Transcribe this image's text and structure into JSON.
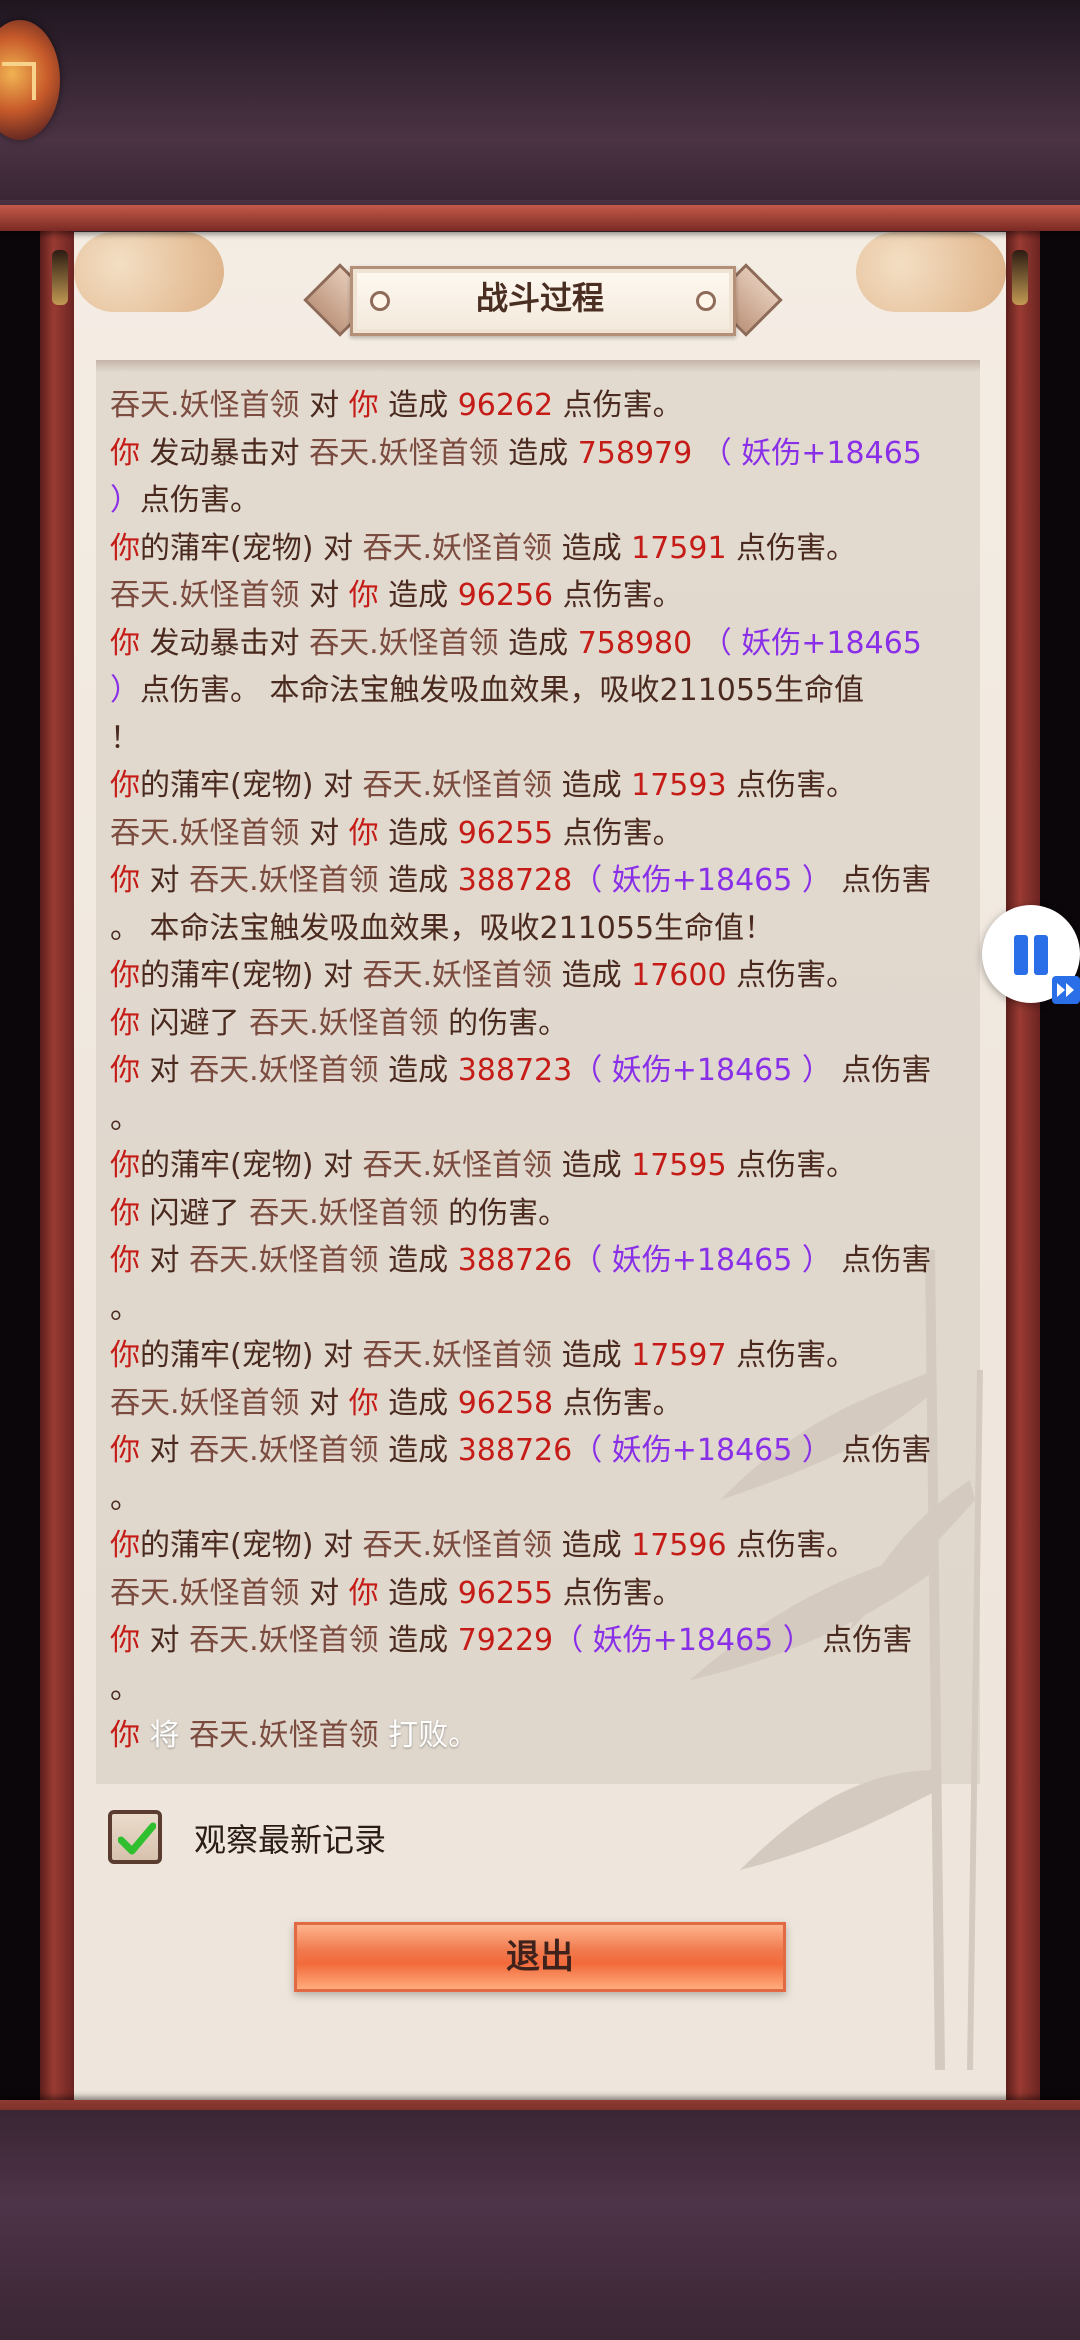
{
  "window": {
    "title": "战斗过程"
  },
  "log": {
    "lines": [
      [
        {
          "t": "吞天.妖怪首领",
          "c": "enemy"
        },
        {
          "t": " 对 ",
          "c": "text"
        },
        {
          "t": "你",
          "c": "you"
        },
        {
          "t": " 造成 ",
          "c": "text"
        },
        {
          "t": "96262",
          "c": "num"
        },
        {
          "t": " 点伤害。",
          "c": "text"
        }
      ],
      [
        {
          "t": "你",
          "c": "you"
        },
        {
          "t": " 发动暴击对 ",
          "c": "text"
        },
        {
          "t": "吞天.妖怪首领",
          "c": "enemy"
        },
        {
          "t": " 造成 ",
          "c": "text"
        },
        {
          "t": "758979",
          "c": "num"
        },
        {
          "t": " （ 妖伤+18465",
          "c": "bonus"
        }
      ],
      [
        {
          "t": "）",
          "c": "bonus"
        },
        {
          "t": "点伤害。",
          "c": "text"
        }
      ],
      [
        {
          "t": "你",
          "c": "you"
        },
        {
          "t": "的蒲牢(宠物) 对 ",
          "c": "text"
        },
        {
          "t": "吞天.妖怪首领",
          "c": "enemy"
        },
        {
          "t": " 造成 ",
          "c": "text"
        },
        {
          "t": "17591",
          "c": "num"
        },
        {
          "t": " 点伤害。",
          "c": "text"
        }
      ],
      [
        {
          "t": "吞天.妖怪首领",
          "c": "enemy"
        },
        {
          "t": " 对 ",
          "c": "text"
        },
        {
          "t": "你",
          "c": "you"
        },
        {
          "t": " 造成 ",
          "c": "text"
        },
        {
          "t": "96256",
          "c": "num"
        },
        {
          "t": " 点伤害。",
          "c": "text"
        }
      ],
      [
        {
          "t": "你",
          "c": "you"
        },
        {
          "t": " 发动暴击对 ",
          "c": "text"
        },
        {
          "t": "吞天.妖怪首领",
          "c": "enemy"
        },
        {
          "t": " 造成 ",
          "c": "text"
        },
        {
          "t": "758980",
          "c": "num"
        },
        {
          "t": " （ 妖伤+18465",
          "c": "bonus"
        }
      ],
      [
        {
          "t": "）",
          "c": "bonus"
        },
        {
          "t": "点伤害。 本命法宝触发吸血效果，吸收211055生命值",
          "c": "text"
        }
      ],
      [
        {
          "t": "！",
          "c": "text"
        }
      ],
      [
        {
          "t": "你",
          "c": "you"
        },
        {
          "t": "的蒲牢(宠物) 对 ",
          "c": "text"
        },
        {
          "t": "吞天.妖怪首领",
          "c": "enemy"
        },
        {
          "t": " 造成 ",
          "c": "text"
        },
        {
          "t": "17593",
          "c": "num"
        },
        {
          "t": " 点伤害。",
          "c": "text"
        }
      ],
      [
        {
          "t": "吞天.妖怪首领",
          "c": "enemy"
        },
        {
          "t": " 对 ",
          "c": "text"
        },
        {
          "t": "你",
          "c": "you"
        },
        {
          "t": " 造成 ",
          "c": "text"
        },
        {
          "t": "96255",
          "c": "num"
        },
        {
          "t": " 点伤害。",
          "c": "text"
        }
      ],
      [
        {
          "t": "你",
          "c": "you"
        },
        {
          "t": " 对 ",
          "c": "text"
        },
        {
          "t": "吞天.妖怪首领",
          "c": "enemy"
        },
        {
          "t": " 造成 ",
          "c": "text"
        },
        {
          "t": "388728",
          "c": "num"
        },
        {
          "t": "（ 妖伤+18465 ）",
          "c": "bonus"
        },
        {
          "t": " 点伤害",
          "c": "text"
        }
      ],
      [
        {
          "t": "。 本命法宝触发吸血效果，吸收211055生命值！",
          "c": "text"
        }
      ],
      [
        {
          "t": "你",
          "c": "you"
        },
        {
          "t": "的蒲牢(宠物) 对 ",
          "c": "text"
        },
        {
          "t": "吞天.妖怪首领",
          "c": "enemy"
        },
        {
          "t": " 造成 ",
          "c": "text"
        },
        {
          "t": "17600",
          "c": "num"
        },
        {
          "t": " 点伤害。",
          "c": "text"
        }
      ],
      [
        {
          "t": "你",
          "c": "you"
        },
        {
          "t": " 闪避了 ",
          "c": "text"
        },
        {
          "t": "吞天.妖怪首领",
          "c": "enemy"
        },
        {
          "t": " 的伤害。",
          "c": "text"
        }
      ],
      [
        {
          "t": "你",
          "c": "you"
        },
        {
          "t": " 对 ",
          "c": "text"
        },
        {
          "t": "吞天.妖怪首领",
          "c": "enemy"
        },
        {
          "t": " 造成 ",
          "c": "text"
        },
        {
          "t": "388723",
          "c": "num"
        },
        {
          "t": "（ 妖伤+18465 ）",
          "c": "bonus"
        },
        {
          "t": " 点伤害",
          "c": "text"
        }
      ],
      [
        {
          "t": "。",
          "c": "text"
        }
      ],
      [
        {
          "t": "你",
          "c": "you"
        },
        {
          "t": "的蒲牢(宠物) 对 ",
          "c": "text"
        },
        {
          "t": "吞天.妖怪首领",
          "c": "enemy"
        },
        {
          "t": " 造成 ",
          "c": "text"
        },
        {
          "t": "17595",
          "c": "num"
        },
        {
          "t": " 点伤害。",
          "c": "text"
        }
      ],
      [
        {
          "t": "你",
          "c": "you"
        },
        {
          "t": " 闪避了 ",
          "c": "text"
        },
        {
          "t": "吞天.妖怪首领",
          "c": "enemy"
        },
        {
          "t": " 的伤害。",
          "c": "text"
        }
      ],
      [
        {
          "t": "你",
          "c": "you"
        },
        {
          "t": " 对 ",
          "c": "text"
        },
        {
          "t": "吞天.妖怪首领",
          "c": "enemy"
        },
        {
          "t": " 造成 ",
          "c": "text"
        },
        {
          "t": "388726",
          "c": "num"
        },
        {
          "t": "（ 妖伤+18465 ）",
          "c": "bonus"
        },
        {
          "t": " 点伤害",
          "c": "text"
        }
      ],
      [
        {
          "t": "。",
          "c": "text"
        }
      ],
      [
        {
          "t": "你",
          "c": "you"
        },
        {
          "t": "的蒲牢(宠物) 对 ",
          "c": "text"
        },
        {
          "t": "吞天.妖怪首领",
          "c": "enemy"
        },
        {
          "t": " 造成 ",
          "c": "text"
        },
        {
          "t": "17597",
          "c": "num"
        },
        {
          "t": " 点伤害。",
          "c": "text"
        }
      ],
      [
        {
          "t": "吞天.妖怪首领",
          "c": "enemy"
        },
        {
          "t": " 对 ",
          "c": "text"
        },
        {
          "t": "你",
          "c": "you"
        },
        {
          "t": " 造成 ",
          "c": "text"
        },
        {
          "t": "96258",
          "c": "num"
        },
        {
          "t": " 点伤害。",
          "c": "text"
        }
      ],
      [
        {
          "t": "你",
          "c": "you"
        },
        {
          "t": " 对 ",
          "c": "text"
        },
        {
          "t": "吞天.妖怪首领",
          "c": "enemy"
        },
        {
          "t": " 造成 ",
          "c": "text"
        },
        {
          "t": "388726",
          "c": "num"
        },
        {
          "t": "（ 妖伤+18465 ）",
          "c": "bonus"
        },
        {
          "t": " 点伤害",
          "c": "text"
        }
      ],
      [
        {
          "t": "。",
          "c": "text"
        }
      ],
      [
        {
          "t": "你",
          "c": "you"
        },
        {
          "t": "的蒲牢(宠物) 对 ",
          "c": "text"
        },
        {
          "t": "吞天.妖怪首领",
          "c": "enemy"
        },
        {
          "t": " 造成 ",
          "c": "text"
        },
        {
          "t": "17596",
          "c": "num"
        },
        {
          "t": " 点伤害。",
          "c": "text"
        }
      ],
      [
        {
          "t": "吞天.妖怪首领",
          "c": "enemy"
        },
        {
          "t": " 对 ",
          "c": "text"
        },
        {
          "t": "你",
          "c": "you"
        },
        {
          "t": " 造成 ",
          "c": "text"
        },
        {
          "t": "96255",
          "c": "num"
        },
        {
          "t": " 点伤害。",
          "c": "text"
        }
      ],
      [
        {
          "t": "你",
          "c": "you"
        },
        {
          "t": " 对 ",
          "c": "text"
        },
        {
          "t": "吞天.妖怪首领",
          "c": "enemy"
        },
        {
          "t": " 造成 ",
          "c": "text"
        },
        {
          "t": "79229",
          "c": "num"
        },
        {
          "t": "（ 妖伤+18465 ）",
          "c": "bonus"
        },
        {
          "t": " 点伤害",
          "c": "text"
        }
      ],
      [
        {
          "t": "。",
          "c": "text"
        }
      ],
      [
        {
          "t": "你",
          "c": "you"
        },
        {
          "t": " 将 ",
          "c": "white"
        },
        {
          "t": "吞天.妖怪首领",
          "c": "enemy"
        },
        {
          "t": " 打败。",
          "c": "white"
        }
      ]
    ]
  },
  "controls": {
    "observe_latest_label": "观察最新记录",
    "observe_latest_checked": true,
    "exit_label": "退出"
  },
  "icons": {
    "pause": "pause-icon",
    "fast_forward": "fast-forward-icon",
    "check": "check-icon"
  },
  "colors": {
    "enemy_name": "#7c4b3f",
    "player_name": "#c61c17",
    "damage_number": "#c61c17",
    "bonus_damage": "#8a2fe8",
    "body_text": "#4a2a1f"
  }
}
